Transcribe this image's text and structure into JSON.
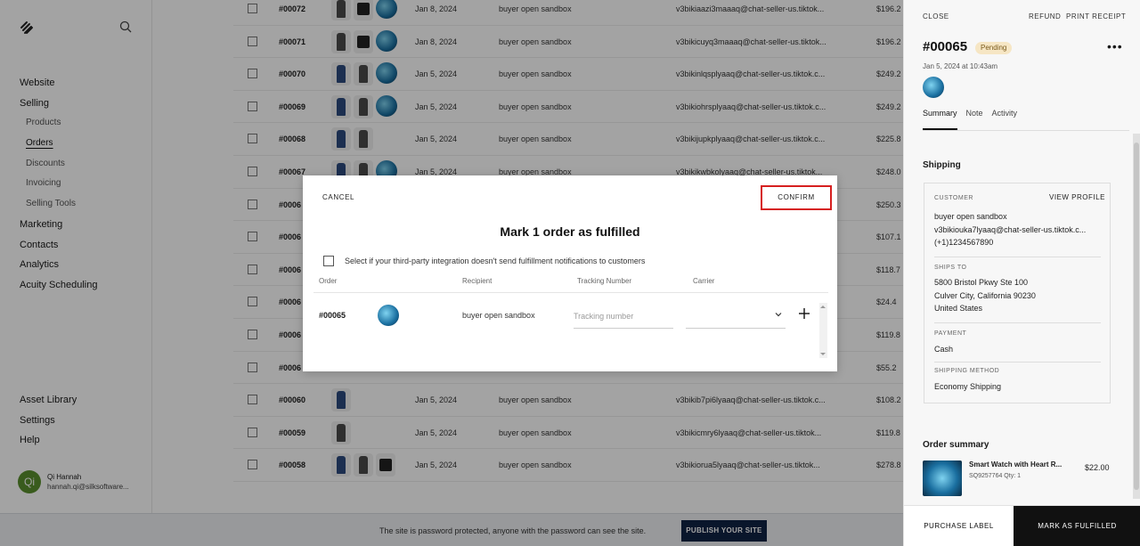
{
  "sidebar": {
    "nav": [
      {
        "label": "Website",
        "sub": false,
        "active": false
      },
      {
        "label": "Selling",
        "sub": false,
        "active": false
      },
      {
        "label": "Products",
        "sub": true,
        "active": false
      },
      {
        "label": "Orders",
        "sub": true,
        "active": true
      },
      {
        "label": "Discounts",
        "sub": true,
        "active": false
      },
      {
        "label": "Invoicing",
        "sub": true,
        "active": false
      },
      {
        "label": "Selling Tools",
        "sub": true,
        "active": false
      },
      {
        "label": "Marketing",
        "sub": false,
        "active": false
      },
      {
        "label": "Contacts",
        "sub": false,
        "active": false
      },
      {
        "label": "Analytics",
        "sub": false,
        "active": false
      },
      {
        "label": "Acuity Scheduling",
        "sub": false,
        "active": false
      }
    ],
    "bottom": [
      "Asset Library",
      "Settings",
      "Help"
    ],
    "user": {
      "initials": "Qi",
      "name": "Qi Hannah",
      "email": "hannah.qi@silksoftware..."
    }
  },
  "orders": [
    {
      "num": "#00072",
      "thumbs": [
        "dress-gray",
        "shirt",
        "watch"
      ],
      "date": "Jan 8, 2024",
      "buyer": "buyer open sandbox",
      "email": "v3bikiaazi3maaaq@chat-seller-us.tiktok...",
      "amount": "$196.2"
    },
    {
      "num": "#00071",
      "thumbs": [
        "dress-gray",
        "shirt",
        "watch"
      ],
      "date": "Jan 8, 2024",
      "buyer": "buyer open sandbox",
      "email": "v3bikicuyq3maaaq@chat-seller-us.tiktok...",
      "amount": "$196.2"
    },
    {
      "num": "#00070",
      "thumbs": [
        "dress-blue",
        "dress-gray",
        "watch"
      ],
      "date": "Jan 5, 2024",
      "buyer": "buyer open sandbox",
      "email": "v3bikinlqsplyaaq@chat-seller-us.tiktok.c...",
      "amount": "$249.2"
    },
    {
      "num": "#00069",
      "thumbs": [
        "dress-blue",
        "dress-gray",
        "watch"
      ],
      "date": "Jan 5, 2024",
      "buyer": "buyer open sandbox",
      "email": "v3bikiohrsplyaaq@chat-seller-us.tiktok.c...",
      "amount": "$249.2"
    },
    {
      "num": "#00068",
      "thumbs": [
        "dress-blue",
        "dress-gray"
      ],
      "date": "Jan 5, 2024",
      "buyer": "buyer open sandbox",
      "email": "v3bikijupkplyaaq@chat-seller-us.tiktok.c...",
      "amount": "$225.8"
    },
    {
      "num": "#00067",
      "thumbs": [
        "dress-blue",
        "dress-gray",
        "watch"
      ],
      "date": "Jan 5, 2024",
      "buyer": "buyer open sandbox",
      "email": "v3bikikwbkolyaaq@chat-seller-us.tiktok...",
      "amount": "$248.0"
    },
    {
      "num": "#0006",
      "thumbs": [],
      "date": "",
      "buyer": "",
      "email": "",
      "amount": "$250.3"
    },
    {
      "num": "#0006",
      "thumbs": [],
      "date": "",
      "buyer": "",
      "email": "",
      "amount": "$107.1"
    },
    {
      "num": "#0006",
      "thumbs": [],
      "date": "",
      "buyer": "",
      "email": "",
      "amount": "$118.7"
    },
    {
      "num": "#0006",
      "thumbs": [],
      "date": "",
      "buyer": "",
      "email": "",
      "amount": "$24.4"
    },
    {
      "num": "#0006",
      "thumbs": [],
      "date": "",
      "buyer": "",
      "email": "",
      "amount": "$119.8"
    },
    {
      "num": "#0006",
      "thumbs": [],
      "date": "",
      "buyer": "",
      "email": "",
      "amount": "$55.2"
    },
    {
      "num": "#00060",
      "thumbs": [
        "dress-blue"
      ],
      "date": "Jan 5, 2024",
      "buyer": "buyer open sandbox",
      "email": "v3bikib7pi6lyaaq@chat-seller-us.tiktok.c...",
      "amount": "$108.2"
    },
    {
      "num": "#00059",
      "thumbs": [
        "dress-gray"
      ],
      "date": "Jan 5, 2024",
      "buyer": "buyer open sandbox",
      "email": "v3bikicmry6lyaaq@chat-seller-us.tiktok...",
      "amount": "$119.8"
    },
    {
      "num": "#00058",
      "thumbs": [
        "dress-blue",
        "dress-gray",
        "shirt"
      ],
      "date": "Jan 5, 2024",
      "buyer": "buyer open sandbox",
      "email": "v3bikiorua5lyaaq@chat-seller-us.tiktok...",
      "amount": "$278.8"
    }
  ],
  "banner": {
    "text": "The site is password protected, anyone with the password can see the site.",
    "publish_label": "PUBLISH YOUR SITE"
  },
  "panel": {
    "close": "CLOSE",
    "refund": "REFUND",
    "print": "PRINT RECEIPT",
    "order_num": "#00065",
    "status": "Pending",
    "more": "•••",
    "timestamp": "Jan 5, 2024 at 10:43am",
    "tabs": [
      "Summary",
      "Note",
      "Activity"
    ],
    "shipping_heading": "Shipping",
    "customer_label": "CUSTOMER",
    "view_profile": "VIEW PROFILE",
    "customer_name": "buyer open sandbox",
    "customer_email": "v3bikiouka7lyaaq@chat-seller-us.tiktok.c...",
    "customer_phone": "(+1)1234567890",
    "ships_to_label": "SHIPS TO",
    "address_1": "5800 Bristol Pkwy Ste 100",
    "address_2": "Culver City, California 90230",
    "address_3": "United States",
    "payment_label": "PAYMENT",
    "payment": "Cash",
    "method_label": "SHIPPING METHOD",
    "method": "Economy Shipping",
    "order_summary_heading": "Order summary",
    "item_name": "Smart Watch with Heart R...",
    "item_sku": "SQ9257764 Qty: 1",
    "item_price": "$22.00",
    "purchase_label": "PURCHASE LABEL",
    "mark_fulfilled": "MARK AS FULFILLED"
  },
  "modal": {
    "cancel": "CANCEL",
    "confirm": "CONFIRM",
    "title": "Mark 1 order as fulfilled",
    "checkbox_text": "Select if your third-party integration doesn't send fulfillment notifications to customers",
    "col_order": "Order",
    "col_recipient": "Recipient",
    "col_tracking": "Tracking Number",
    "col_carrier": "Carrier",
    "row_order": "#00065",
    "row_recipient": "buyer open sandbox",
    "tracking_placeholder": "Tracking number",
    "tracking_value": "",
    "carrier_value": ""
  }
}
